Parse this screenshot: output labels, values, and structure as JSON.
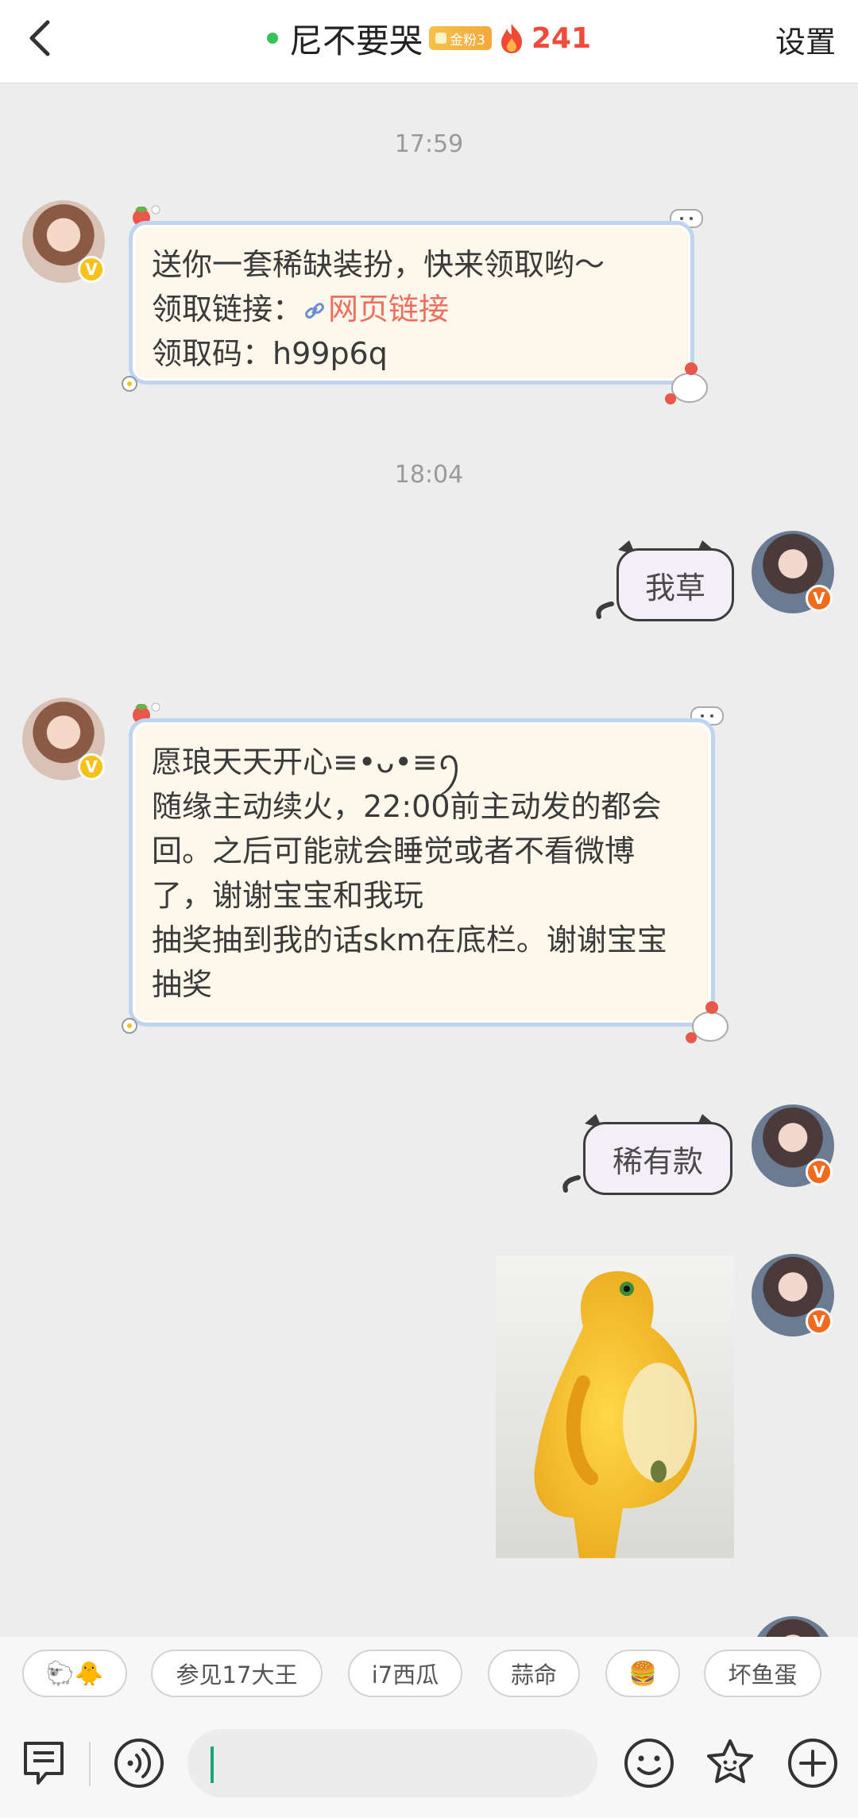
{
  "header": {
    "title": "尼不要哭",
    "badge_text": "金粉3",
    "fire_count": "241",
    "settings_label": "设置"
  },
  "messages": {
    "time_1": "17:59",
    "card_1": {
      "line1": "送你一套稀缺装扮，快来领取哟～",
      "line2_prefix": "领取链接：",
      "link_text": "网页链接",
      "line3": "领取码：h99p6q"
    },
    "time_2": "18:04",
    "sticker_1": "我草",
    "card_2": {
      "line1": "愿琅天天开心≡•ᴗ•≡ꪆ",
      "line2": "随缘主动续火，22:00前主动发的都会回。之后可能就会睡觉或者不看微博了，谢谢宝宝和我玩",
      "line3": "抽奖抽到我的话skm在底栏。谢谢宝宝抽奖"
    },
    "sticker_2": "稀有款"
  },
  "quick_replies": [
    {
      "label": "🐑🐥"
    },
    {
      "label": "参见17大王"
    },
    {
      "label": "i7西瓜"
    },
    {
      "label": "蒜命"
    },
    {
      "label": "🍔"
    },
    {
      "label": "坏鱼蛋"
    }
  ],
  "input": {
    "value": "",
    "placeholder": ""
  },
  "colors": {
    "accent_link": "#ef6e5e",
    "fire": "#f04a3b",
    "online": "#35c35a",
    "caret": "#19a77a",
    "card_border": "#bed4ef"
  },
  "icons": {
    "back": "chevron-left-icon",
    "fire": "fire-icon",
    "link": "link-icon",
    "menu": "text-menu-icon",
    "voice": "voice-icon",
    "emoji": "smiley-icon",
    "sticker": "sticker-icon",
    "add": "plus-circle-icon"
  }
}
